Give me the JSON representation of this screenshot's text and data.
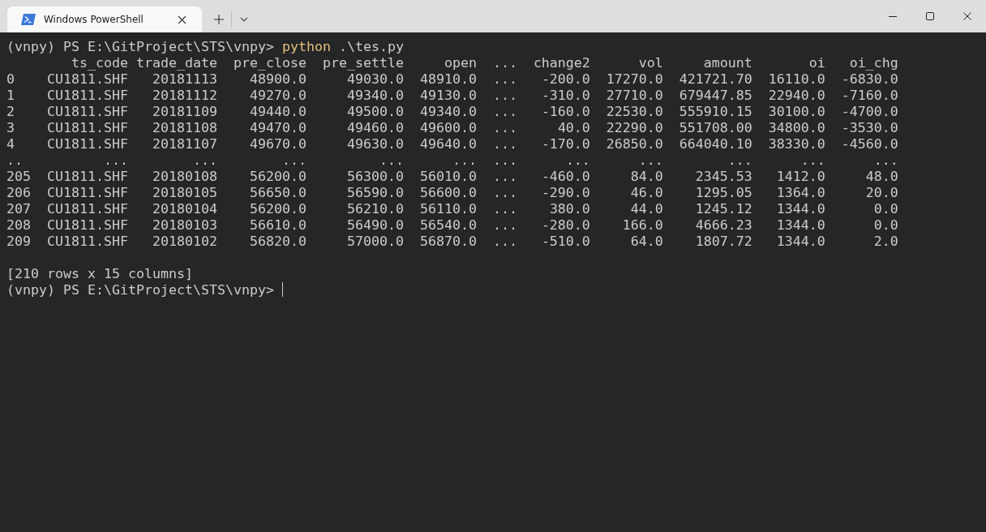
{
  "window": {
    "tabs": [
      {
        "title": "Windows PowerShell",
        "selected": true
      }
    ]
  },
  "terminal": {
    "lines": [
      {
        "kind": "prompt",
        "prompt": "(vnpy) PS E:\\GitProject\\STS\\vnpy>",
        "command": "python",
        "args": ".\\tes.py",
        "cursor": false
      },
      {
        "kind": "table",
        "columns": [
          "ts_code",
          "trade_date",
          "pre_close",
          "pre_settle",
          "open",
          "...",
          "change2",
          "vol",
          "amount",
          "oi",
          "oi_chg"
        ],
        "rows": [
          {
            "index": "0",
            "cells": [
              "CU1811.SHF",
              "20181113",
              "48900.0",
              "49030.0",
              "48910.0",
              "...",
              "-200.0",
              "17270.0",
              "421721.70",
              "16110.0",
              "-6830.0"
            ]
          },
          {
            "index": "1",
            "cells": [
              "CU1811.SHF",
              "20181112",
              "49270.0",
              "49340.0",
              "49130.0",
              "...",
              "-310.0",
              "27710.0",
              "679447.85",
              "22940.0",
              "-7160.0"
            ]
          },
          {
            "index": "2",
            "cells": [
              "CU1811.SHF",
              "20181109",
              "49440.0",
              "49500.0",
              "49340.0",
              "...",
              "-160.0",
              "22530.0",
              "555910.15",
              "30100.0",
              "-4700.0"
            ]
          },
          {
            "index": "3",
            "cells": [
              "CU1811.SHF",
              "20181108",
              "49470.0",
              "49460.0",
              "49600.0",
              "...",
              "40.0",
              "22290.0",
              "551708.00",
              "34800.0",
              "-3530.0"
            ]
          },
          {
            "index": "4",
            "cells": [
              "CU1811.SHF",
              "20181107",
              "49670.0",
              "49630.0",
              "49640.0",
              "...",
              "-170.0",
              "26850.0",
              "664040.10",
              "38330.0",
              "-4560.0"
            ]
          },
          {
            "index": "..",
            "cells": [
              "...",
              "...",
              "...",
              "...",
              "...",
              "...",
              "...",
              "...",
              "...",
              "...",
              "..."
            ]
          },
          {
            "index": "205",
            "cells": [
              "CU1811.SHF",
              "20180108",
              "56200.0",
              "56300.0",
              "56010.0",
              "...",
              "-460.0",
              "84.0",
              "2345.53",
              "1412.0",
              "48.0"
            ]
          },
          {
            "index": "206",
            "cells": [
              "CU1811.SHF",
              "20180105",
              "56650.0",
              "56590.0",
              "56600.0",
              "...",
              "-290.0",
              "46.0",
              "1295.05",
              "1364.0",
              "20.0"
            ]
          },
          {
            "index": "207",
            "cells": [
              "CU1811.SHF",
              "20180104",
              "56200.0",
              "56210.0",
              "56110.0",
              "...",
              "380.0",
              "44.0",
              "1245.12",
              "1344.0",
              "0.0"
            ]
          },
          {
            "index": "208",
            "cells": [
              "CU1811.SHF",
              "20180103",
              "56610.0",
              "56490.0",
              "56540.0",
              "...",
              "-280.0",
              "166.0",
              "4666.23",
              "1344.0",
              "0.0"
            ]
          },
          {
            "index": "209",
            "cells": [
              "CU1811.SHF",
              "20180102",
              "56820.0",
              "57000.0",
              "56870.0",
              "...",
              "-510.0",
              "64.0",
              "1807.72",
              "1344.0",
              "2.0"
            ]
          }
        ]
      },
      {
        "kind": "blank"
      },
      {
        "kind": "text",
        "text": "[210 rows x 15 columns]"
      },
      {
        "kind": "prompt",
        "prompt": "(vnpy) PS E:\\GitProject\\STS\\vnpy>",
        "cursor": true
      }
    ]
  }
}
